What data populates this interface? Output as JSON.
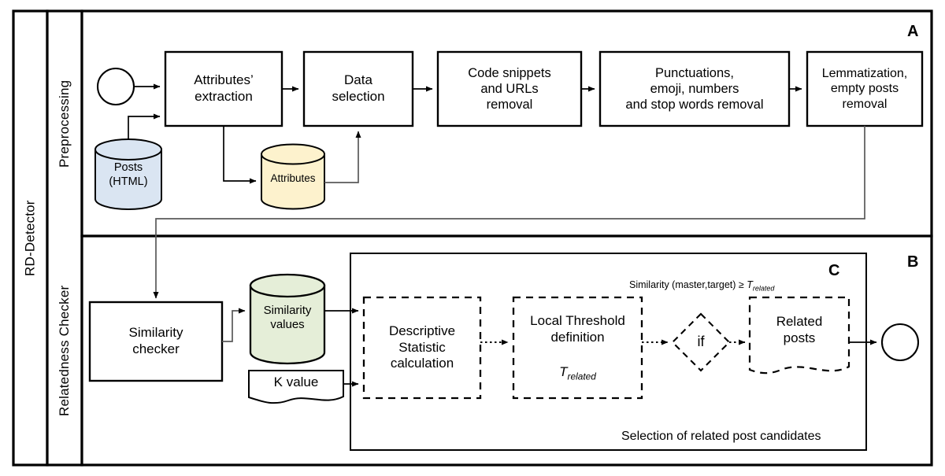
{
  "figure": {
    "outer_lane_label": "RD-Detector",
    "lanes": [
      {
        "label": "Preprocessing",
        "tag": "A"
      },
      {
        "label": "Relatedness Checker",
        "tag": "B"
      }
    ],
    "inner_group": {
      "tag": "C",
      "caption": "Selection of related post candidates"
    }
  },
  "preprocessing": {
    "start_node": "",
    "steps": [
      {
        "id": "attributes-extraction",
        "label": "Attributes’\nextraction"
      },
      {
        "id": "data-selection",
        "label": "Data\nselection"
      },
      {
        "id": "code-urls-removal",
        "label": "Code snippets\nand URLs\nremoval"
      },
      {
        "id": "punctuation-removal",
        "label": "Punctuations,\nemoji, numbers\nand stop words removal"
      },
      {
        "id": "lemmatization",
        "label": "Lemmatization,\nempty posts\nremoval"
      }
    ],
    "datastores": [
      {
        "id": "posts-html",
        "label": "Posts\n(HTML)",
        "color": "#dae5f2"
      },
      {
        "id": "attributes",
        "label": "Attributes",
        "color": "#fdf2cd"
      }
    ]
  },
  "relatedness": {
    "steps": [
      {
        "id": "similarity-checker",
        "label": "Similarity\nchecker"
      },
      {
        "id": "descriptive-statistic",
        "label": "Descriptive\nStatistic\ncalculation"
      },
      {
        "id": "local-threshold",
        "label": "Local Threshold\ndefinition",
        "sub": "T",
        "sub_index": "related"
      },
      {
        "id": "if-decision",
        "label": "if"
      },
      {
        "id": "related-posts",
        "label": "Related\nposts"
      }
    ],
    "datastores": [
      {
        "id": "similarity-values",
        "label": "Similarity\nvalues",
        "color": "#e5eed8"
      }
    ],
    "inputs": [
      {
        "id": "k-value",
        "label": "K value"
      }
    ],
    "condition": {
      "prefix": "Similarity (master,target) ≥ ",
      "symbol": "T",
      "subscript": "related"
    },
    "end_node": ""
  },
  "style": {
    "stroke": "#000000",
    "thin_stroke": "#595959",
    "fill": "#ffffff"
  }
}
